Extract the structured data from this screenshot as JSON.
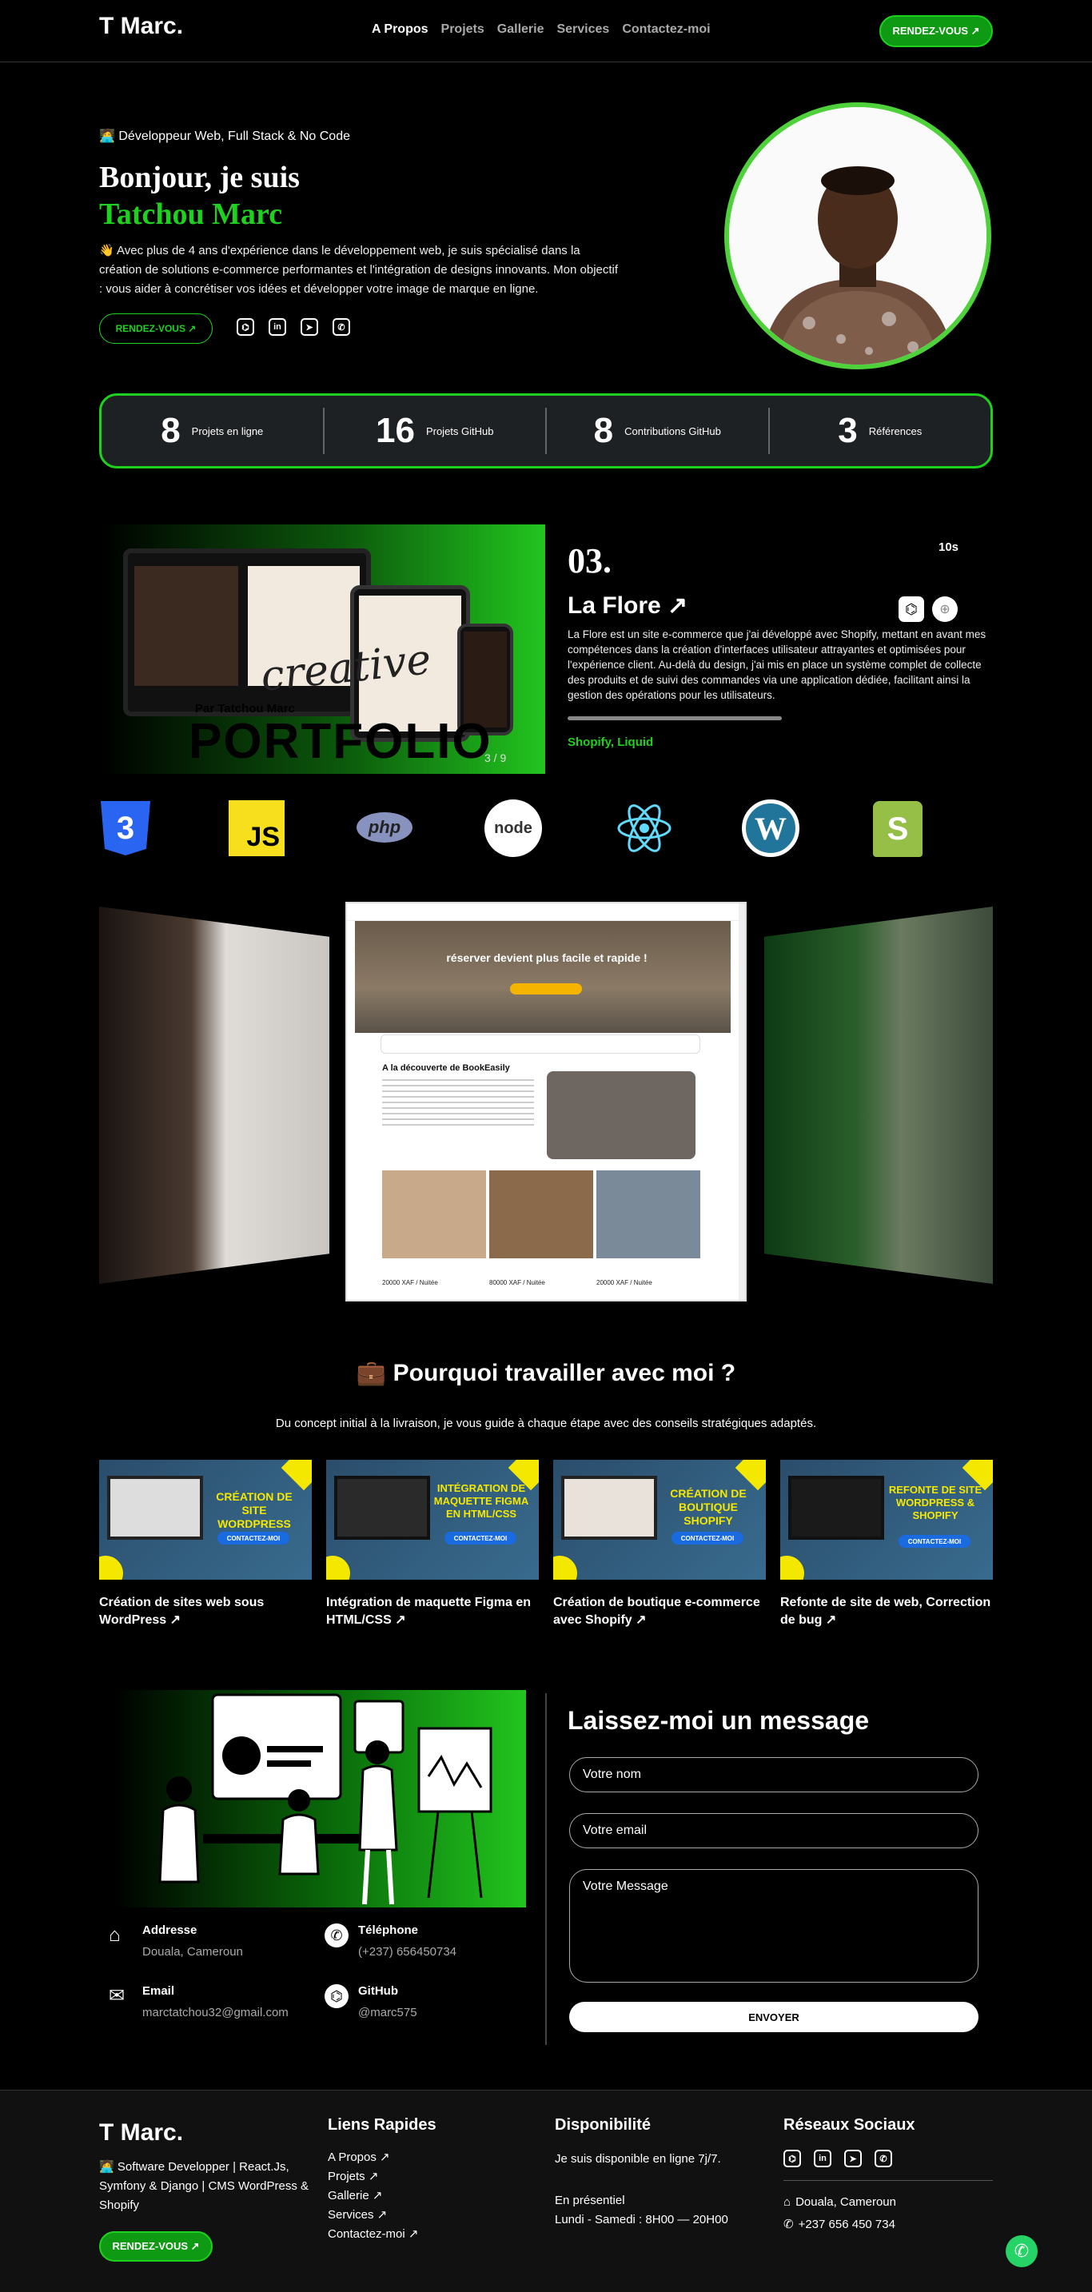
{
  "header": {
    "logo": "T Marc.",
    "nav": [
      "A Propos",
      "Projets",
      "Gallerie",
      "Services",
      "Contactez-moi"
    ],
    "cta": "RENDEZ-VOUS ↗"
  },
  "hero": {
    "tag": "🧑‍💻 Développeur Web, Full Stack & No Code",
    "title1": "Bonjour, je suis",
    "title2": "Tatchou Marc",
    "desc": "👋 Avec plus de 4 ans d'expérience dans le développement web, je suis spécialisé dans la création de solutions e-commerce performantes et l'intégration de designs innovants. Mon objectif : vous aider à concrétiser vos idées et développer votre image de marque en ligne.",
    "cta": "RENDEZ-VOUS ↗",
    "socials": [
      "github-icon",
      "linkedin-icon",
      "telegram-icon",
      "whatsapp-icon"
    ]
  },
  "stats": [
    {
      "n": "8",
      "l": "Projets en ligne"
    },
    {
      "n": "16",
      "l": "Projets GitHub"
    },
    {
      "n": "8",
      "l": "Contributions GitHub"
    },
    {
      "n": "3",
      "l": "Références"
    }
  ],
  "project": {
    "num": "03.",
    "timer": "10s",
    "name": "La Flore ↗",
    "desc": "La Flore est un site e-commerce que j'ai développé avec Shopify, mettant en avant mes compétences dans la création d'interfaces utilisateur attrayantes et optimisées pour l'expérience client. Au-delà du design, j'ai mis en place un système complet de collecte des produits et de suivi des commandes via une application dédiée, facilitant ainsi la gestion des opérations pour les utilisateurs.",
    "tech": "Shopify, Liquid",
    "counter": "3 / 9",
    "img_text1": "creative",
    "img_text2": "Par Tatchou Marc",
    "img_text3": "PORTFOLIO"
  },
  "techs": [
    "CSS3",
    "JS",
    "php",
    "node",
    "React",
    "WordPress",
    "Shopify"
  ],
  "gallery": {
    "center_title": "réserver devient plus facile et rapide !",
    "center_sub": "A la découverte de BookEasily",
    "prices": [
      "20000 XAF / Nuitée",
      "80000 XAF / Nuitée",
      "20000 XAF / Nuitée"
    ]
  },
  "why": {
    "title": "💼 Pourquoi travailler avec moi ?",
    "sub": "Du concept initial à la livraison, je vous guide à chaque étape avec des conseils stratégiques adaptés.",
    "cards": [
      {
        "banner": "CRÉATION DE SITE WORDPRESS",
        "cta": "CONTACTEZ-MOI",
        "title": "Création de sites web sous WordPress ↗"
      },
      {
        "banner": "INTÉGRATION DE MAQUETTE FIGMA EN HTML/CSS",
        "cta": "CONTACTEZ-MOI",
        "title": "Intégration de maquette Figma en HTML/CSS ↗"
      },
      {
        "banner": "CRÉATION DE BOUTIQUE SHOPIFY",
        "cta": "CONTACTEZ-MOI",
        "title": "Création de boutique e-commerce avec Shopify ↗"
      },
      {
        "banner": "REFONTE DE SITE WORDPRESS & SHOPIFY",
        "cta": "CONTACTEZ-MOI",
        "title": "Refonte de site de web, Correction de bug ↗"
      }
    ]
  },
  "contact": {
    "title": "Laissez-moi un message",
    "name_ph": "Votre nom",
    "email_ph": "Votre email",
    "msg_ph": "Votre Message",
    "send": "ENVOYER",
    "info": [
      {
        "label": "Addresse",
        "value": "Douala, Cameroun",
        "icon": "house-icon"
      },
      {
        "label": "Téléphone",
        "value": "(+237) 656450734",
        "icon": "phone-icon"
      },
      {
        "label": "Email",
        "value": "marctatchou32@gmail.com",
        "icon": "mail-icon"
      },
      {
        "label": "GitHub",
        "value": "@marc575",
        "icon": "github-icon"
      }
    ]
  },
  "footer": {
    "logo": "T Marc.",
    "about": "🧑‍💻 Software Developper | React.Js, Symfony & Django | CMS WordPress & Shopify",
    "cta": "RENDEZ-VOUS ↗",
    "links_title": "Liens Rapides",
    "links": [
      "A Propos ↗",
      "Projets ↗",
      "Gallerie ↗",
      "Services ↗",
      "Contactez-moi ↗"
    ],
    "dispo_title": "Disponibilité",
    "dispo1": "Je suis disponible en ligne 7j/7.",
    "dispo2": "En présentiel",
    "dispo3": "Lundi - Samedi : 8H00 — 20H00",
    "social_title": "Réseaux Sociaux",
    "addr": "Douala, Cameroun",
    "phone": "+237 656 450 734"
  }
}
